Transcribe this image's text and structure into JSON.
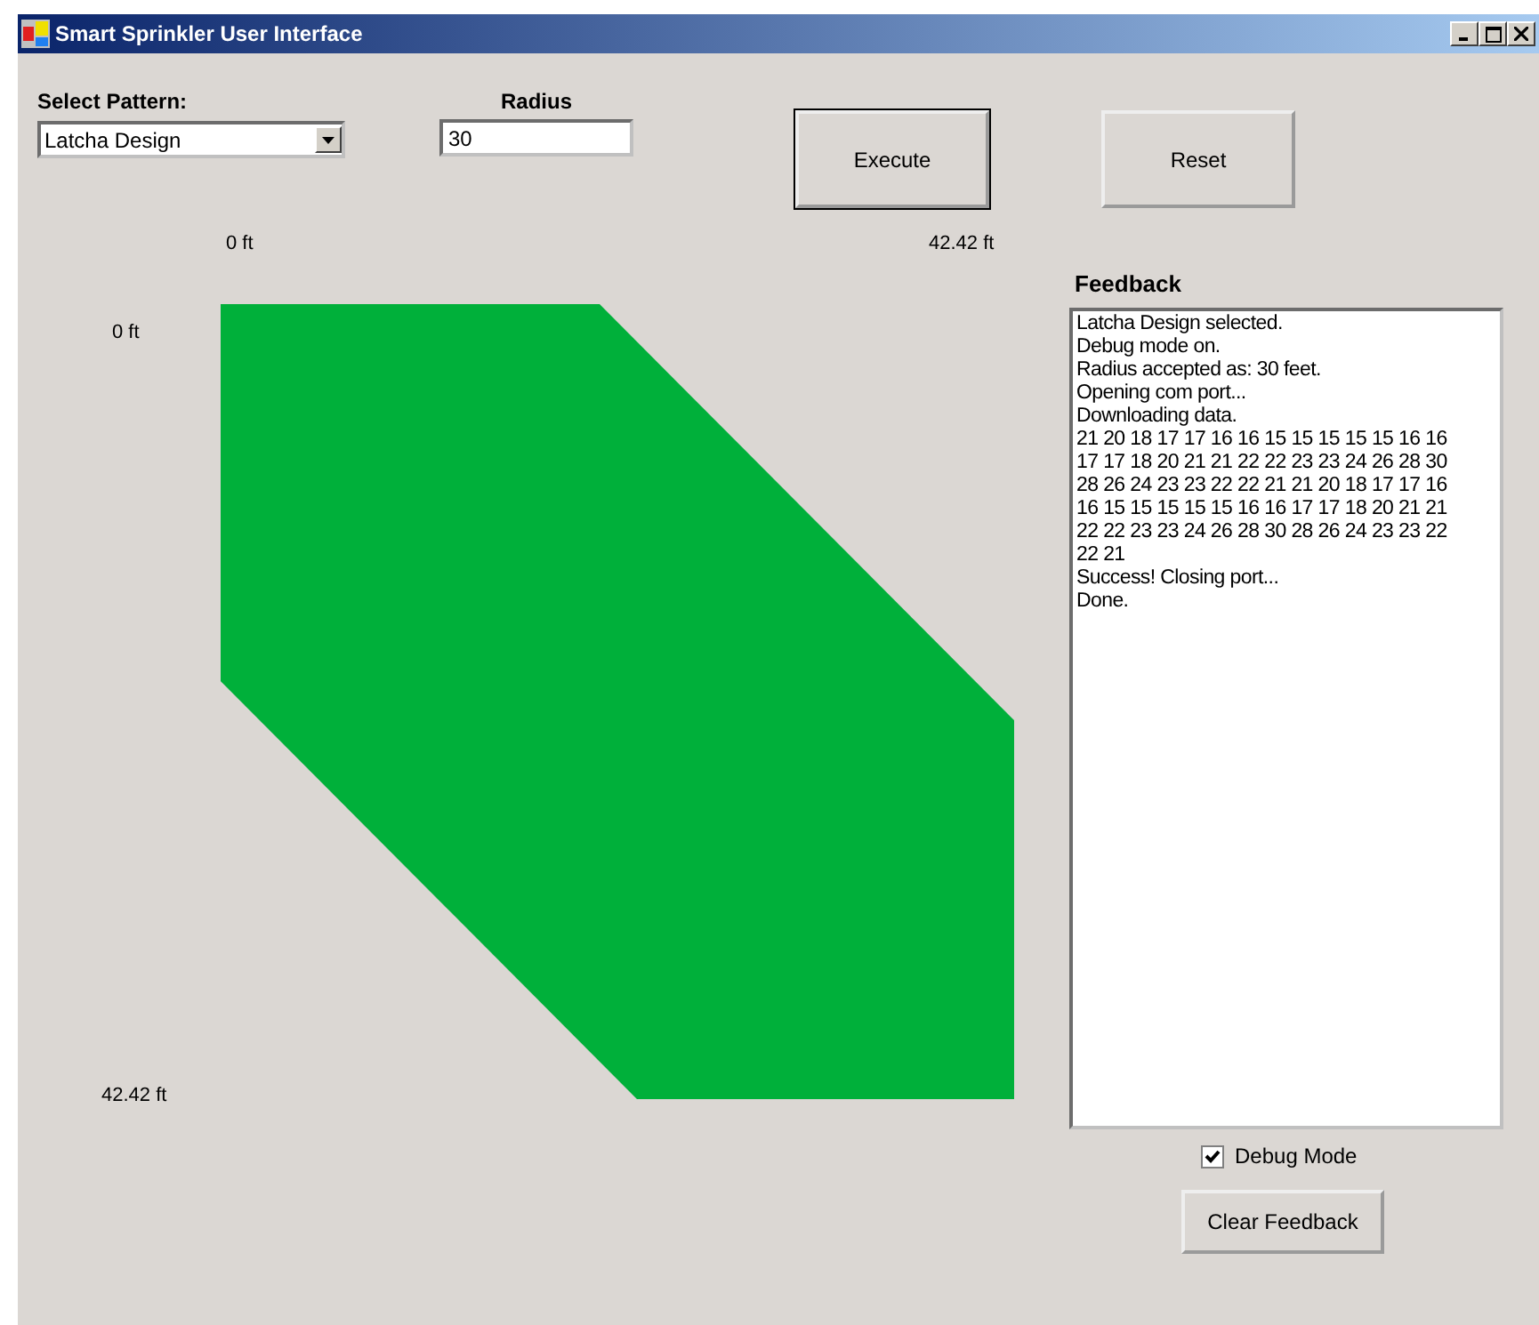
{
  "window": {
    "title": "Smart Sprinkler User Interface"
  },
  "pattern": {
    "label": "Select Pattern:",
    "value": "Latcha Design"
  },
  "radius": {
    "label": "Radius",
    "value": "30"
  },
  "buttons": [
    {
      "label": "Execute",
      "default": true
    },
    {
      "label": "Reset",
      "default": false
    }
  ],
  "plot": {
    "x_start": "0 ft",
    "x_end": "42.42 ft",
    "y_start": "0 ft",
    "y_end": "42.42 ft"
  },
  "feedback": {
    "label": "Feedback",
    "lines": [
      "Latcha Design selected.",
      "Debug mode on.",
      "Radius accepted as: 30 feet.",
      "Opening com port...",
      "Downloading data.",
      "21 20 18 17 17 16 16 15 15 15 15 15 16 16",
      "17 17 18 20 21 21 22 22 23 23 24 26 28 30",
      "28 26 24 23 23 22 22 21 21 20 18 17 17 16",
      "16 15 15 15 15 15 16 16 17 17 18 20 21 21",
      "22 22 23 23 24 26 28 30 28 26 24 23 23 22",
      "22 21",
      "Success! Closing port...",
      "Done."
    ]
  },
  "debug_mode": {
    "label": "Debug Mode",
    "checked": true
  },
  "clear_button": {
    "label": "Clear Feedback"
  }
}
